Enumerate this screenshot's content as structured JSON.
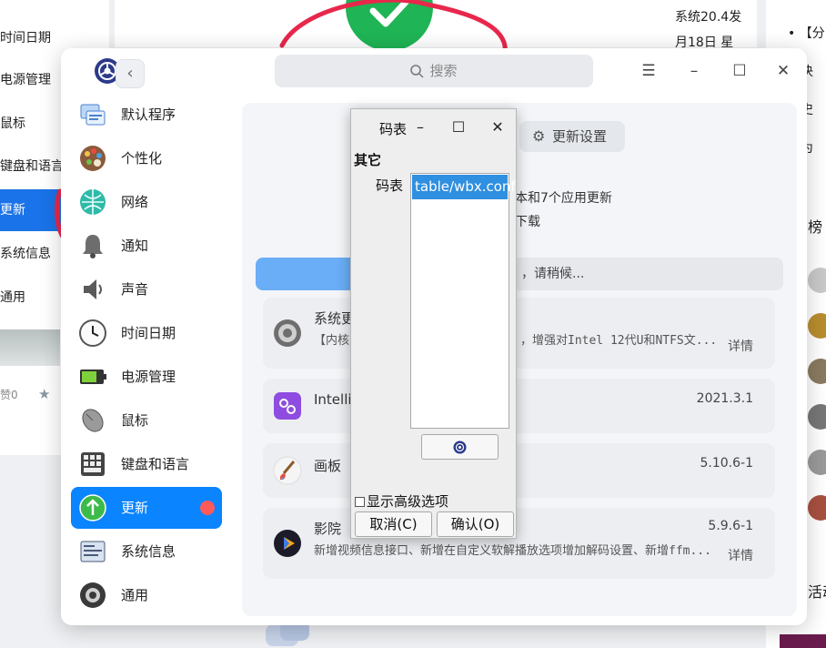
{
  "background": {
    "left_menu": [
      "时间日期",
      "电源管理",
      "鼠标",
      "键盘和语言",
      "更新",
      "系统信息",
      "通用"
    ],
    "likes": "赞0",
    "news_lines": [
      "系统20.4发",
      "月18日 星"
    ],
    "right_texts": [
      "【分",
      "解决",
      "【史",
      "华为",
      "榜",
      "活动"
    ]
  },
  "window": {
    "search_placeholder": "搜索",
    "back_symbol": "‹",
    "menu_symbol": "☰",
    "minimize_symbol": "–",
    "maximize_symbol": "☐",
    "close_symbol": "✕"
  },
  "sidebar": {
    "items": [
      {
        "label": "默认程序",
        "icon": "default-apps-icon"
      },
      {
        "label": "个性化",
        "icon": "personalization-icon"
      },
      {
        "label": "网络",
        "icon": "network-icon"
      },
      {
        "label": "通知",
        "icon": "bell-icon"
      },
      {
        "label": "声音",
        "icon": "speaker-icon"
      },
      {
        "label": "时间日期",
        "icon": "clock-icon"
      },
      {
        "label": "电源管理",
        "icon": "battery-icon"
      },
      {
        "label": "鼠标",
        "icon": "mouse-icon"
      },
      {
        "label": "键盘和语言",
        "icon": "keyboard-icon"
      },
      {
        "label": "更新",
        "icon": "update-icon",
        "active": true,
        "badge": true
      },
      {
        "label": "系统信息",
        "icon": "system-info-icon"
      },
      {
        "label": "通用",
        "icon": "general-icon"
      }
    ]
  },
  "update": {
    "settings_tab": "更新设置",
    "info_line1": "本和7个应用更新",
    "info_line2": "下载",
    "progress_text": "，请稍候...",
    "progress_fraction": 0.18,
    "apps": [
      {
        "name": "系统更",
        "desc": "【内核",
        "desc_tail": "，增强对Intel 12代U和NTFS文...",
        "version": "",
        "detail": "详情"
      },
      {
        "name": "Intelli...",
        "desc": "",
        "desc_tail": "",
        "version": "2021.3.1",
        "detail": ""
      },
      {
        "name": "画板",
        "desc": "",
        "desc_tail": "",
        "version": "5.10.6-1",
        "detail": ""
      },
      {
        "name": "影院",
        "desc": "新增视频信息接口、新增在自定义软解播放选项增加解码设置、新增ffm...",
        "desc_tail": "",
        "version": "5.9.6-1",
        "detail": "详情"
      }
    ]
  },
  "dialog": {
    "title": "码表",
    "minimize_symbol": "–",
    "maximize_symbol": "☐",
    "close_symbol": "✕",
    "section": "其它",
    "field_label": "码表",
    "list_items": [
      "table/wbx.conf"
    ],
    "advanced_label": "显示高级选项",
    "cancel_label": "取消(C)",
    "ok_label": "确认(O)"
  }
}
